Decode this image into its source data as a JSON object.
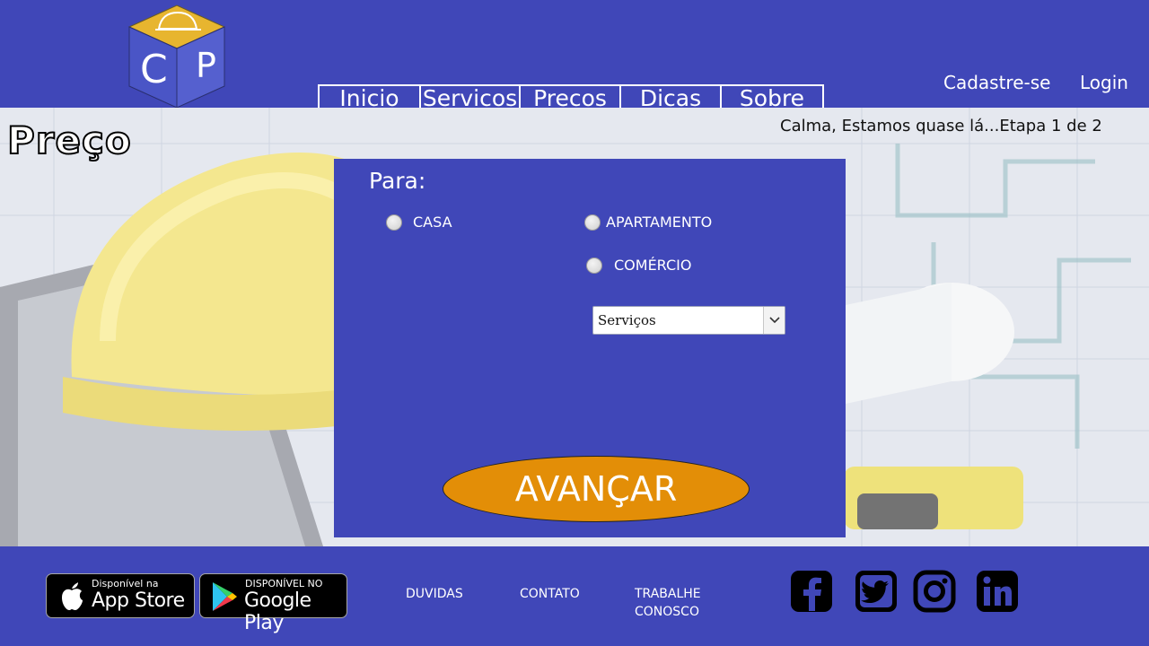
{
  "header": {
    "logo_letters": [
      "C",
      "P"
    ],
    "nav": [
      "Inicio",
      "Servicos",
      "Precos",
      "Dicas",
      "Sobre"
    ],
    "signup": "Cadastre-se",
    "login": "Login"
  },
  "page": {
    "title": "Preço",
    "step": "Calma, Estamos quase lá...Etapa 1 de 2"
  },
  "form": {
    "heading": "Para:",
    "options": [
      "CASA",
      "APARTAMENTO",
      "COMÉRCIO"
    ],
    "select_value": "Serviços",
    "submit": "AVANÇAR"
  },
  "footer": {
    "appstore_small": "Disponível na",
    "appstore_big": "App Store",
    "googleplay_small": "DISPONÍVEL NO",
    "googleplay_big": "Google Play",
    "links": [
      "DUVIDAS",
      "CONTATO",
      "TRABALHE CONOSCO"
    ],
    "social": [
      "facebook-icon",
      "twitter-icon",
      "instagram-icon",
      "linkedin-icon"
    ]
  },
  "colors": {
    "primary": "#4047b8",
    "button": "#e38e07"
  }
}
